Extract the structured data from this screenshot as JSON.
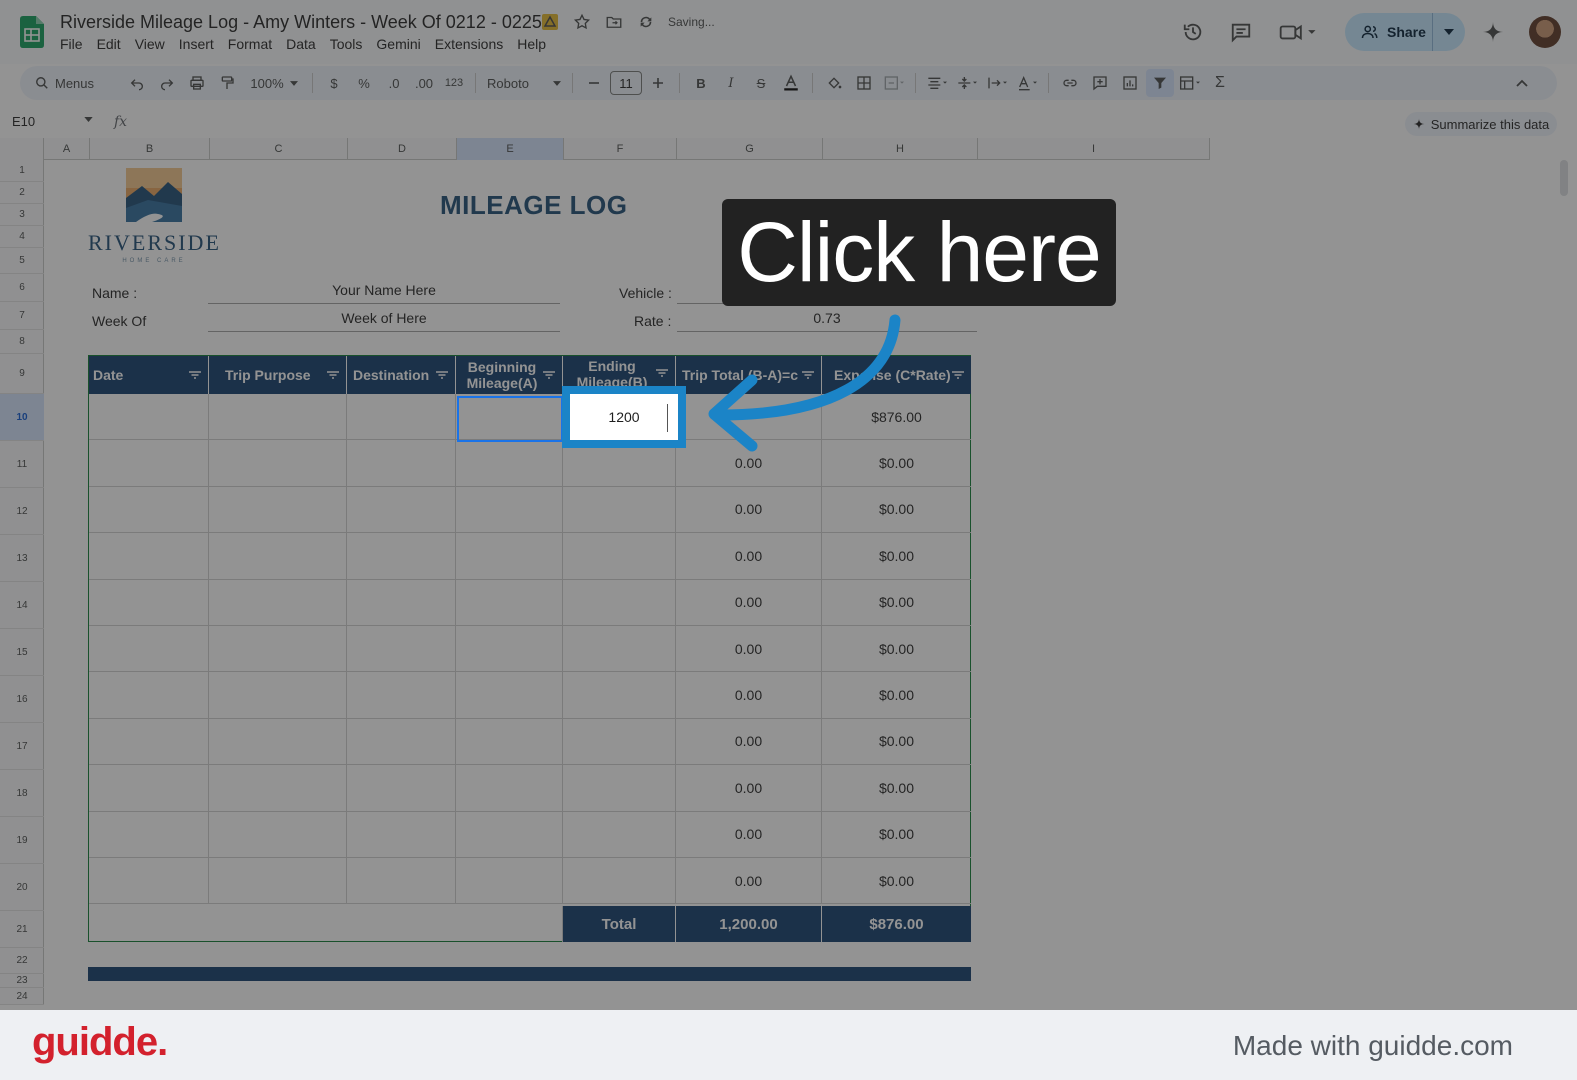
{
  "doc": {
    "title": "Riverside Mileage Log - Amy Winters - Week Of 0212 - 0225",
    "saving_status": "Saving..."
  },
  "menus": [
    "File",
    "Edit",
    "View",
    "Insert",
    "Format",
    "Data",
    "Tools",
    "Gemini",
    "Extensions",
    "Help"
  ],
  "header": {
    "share_label": "Share"
  },
  "toolbar": {
    "menus_label": "Menus",
    "zoom": "100%",
    "currency": "$",
    "percent": "%",
    "dec_decrease": ".0",
    "dec_increase": ".00",
    "number_format": "123",
    "font": "Roboto",
    "font_size": "11"
  },
  "formula_bar": {
    "name_box": "E10",
    "fx": "fx",
    "summarize": "Summarize this data"
  },
  "columns": [
    "A",
    "B",
    "C",
    "D",
    "E",
    "F",
    "G",
    "H",
    "I"
  ],
  "rows": [
    "1",
    "2",
    "3",
    "4",
    "5",
    "6",
    "7",
    "8",
    "9",
    "10",
    "11",
    "12",
    "13",
    "14",
    "15",
    "16",
    "17",
    "18",
    "19",
    "20",
    "21",
    "22",
    "23",
    "24"
  ],
  "sheet": {
    "logo_word": "RIVERSIDE",
    "logo_sub": "HOME CARE",
    "title": "MILEAGE LOG",
    "name_label": "Name :",
    "name_value": "Your Name Here",
    "week_label": "Week Of",
    "week_value": "Week of Here",
    "vehicle_label": "Vehicle :",
    "vehicle_value": "",
    "rate_label": "Rate :",
    "rate_value": "0.73",
    "table_headers": [
      "Date",
      "Trip Purpose",
      "Destination",
      "Beginning Mileage(A)",
      "Ending Mileage(B)",
      "Trip Total (B-A)=c",
      "Expense (C*Rate)"
    ],
    "trip_totals": [
      "",
      "0.00",
      "0.00",
      "0.00",
      "0.00",
      "0.00",
      "0.00",
      "0.00",
      "0.00",
      "0.00",
      "0.00"
    ],
    "expenses": [
      "$876.00",
      "$0.00",
      "$0.00",
      "$0.00",
      "$0.00",
      "$0.00",
      "$0.00",
      "$0.00",
      "$0.00",
      "$0.00",
      "$0.00"
    ],
    "total_label": "Total",
    "total_trip": "1,200.00",
    "total_expense": "$876.00"
  },
  "overlay": {
    "callout_text": "Click here",
    "focus_value": "1200",
    "highlight_color": "#1b84c7"
  },
  "footer": {
    "brand": "guidde.",
    "made_with": "Made with guidde.com"
  }
}
